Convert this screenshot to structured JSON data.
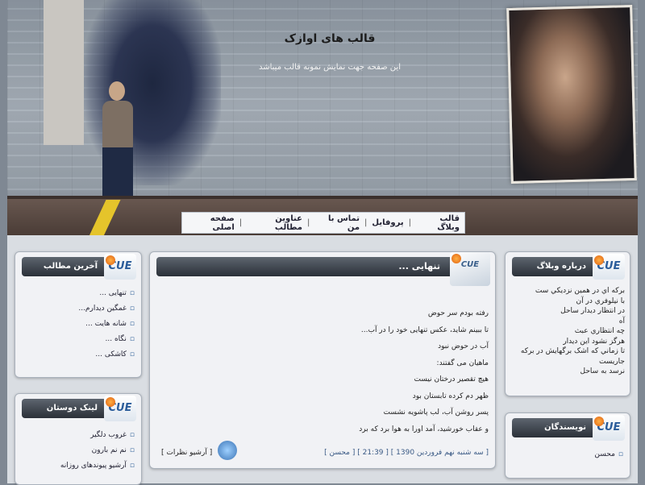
{
  "header": {
    "site_title": "قالب های اوازک",
    "site_desc": "این صفحه جهت نمایش نمونه قالب میباشد"
  },
  "nav": {
    "items": [
      "صفحه اصلی",
      "عناوین مطالب",
      "تماس با من",
      "پروفایل",
      "قالب وبلاگ"
    ]
  },
  "boxes": {
    "latest_posts": {
      "title": "آخرین مطالب",
      "items": [
        "تنهایی ...",
        "غمگین دیدارم...",
        "شانه هایت ...",
        "نگاه ...",
        "کاشکی ..."
      ]
    },
    "friends": {
      "title": "لینک دوستان",
      "items": [
        "غروب دلگیر",
        "نم نم بارون",
        "آرشیو پیوندهای روزانه"
      ]
    },
    "about": {
      "title": "درباره وبلاگ",
      "lines": [
        "برکه اي در همين نزديکي ست",
        "با نيلوفري در آن",
        "در انتظار ديدار ساحل",
        "آه",
        "چه انتظاري عبث",
        "هرگز نشود اين ديدار",
        "تا زماني که اشک برگهايش در برکه جاريست",
        "نرسد به ساحل"
      ]
    },
    "authors": {
      "title": "نویسندگان",
      "items": [
        "محسن"
      ]
    }
  },
  "post": {
    "title": "تنهایی ...",
    "lines": [
      "رفته بودم سر حوض",
      "تا ببینم شاید، عکس تنهایی خود را در آب...",
      "آب در حوض نبود",
      "ماهیان می گفتند:",
      "هیچ تقصیر درختان نیست",
      "ظهر دم کرده تابستان بود",
      "پسر روشن آب، لب پاشویه نشست",
      "و عقاب خورشید، آمد اورا به هوا برد که برد"
    ],
    "footer": "[ سه شنبه نهم فروردین 1390 ] [ 21:39 ] [ محسن ]",
    "archive": "[ آرشیو نظرات ]"
  },
  "logo_text": "CUE"
}
